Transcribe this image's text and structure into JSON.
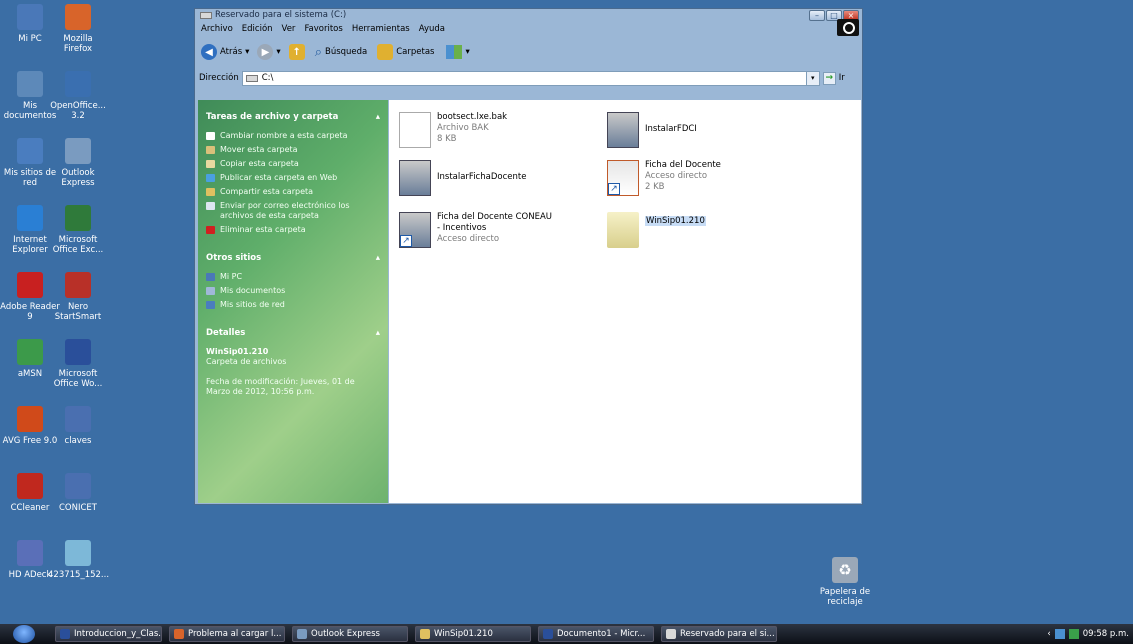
{
  "desktop_icons": [
    {
      "label": "Mi PC",
      "icon": "computer-icon",
      "color": "#4a78b8"
    },
    {
      "label": "Mozilla Firefox",
      "icon": "firefox-icon",
      "color": "#d8642a"
    },
    {
      "label": "Mis documentos",
      "icon": "folder-documents-icon",
      "color": "#5d89b9"
    },
    {
      "label": "OpenOffice... 3.2",
      "icon": "openoffice-icon",
      "color": "#3a6fb0"
    },
    {
      "label": "Mis sitios de red",
      "icon": "network-icon",
      "color": "#4a7dbf"
    },
    {
      "label": "Outlook Express",
      "icon": "outlook-express-icon",
      "color": "#7a9bc0"
    },
    {
      "label": "Internet Explorer",
      "icon": "internet-explorer-icon",
      "color": "#2a7fd4"
    },
    {
      "label": "Microsoft Office Exc...",
      "icon": "excel-icon",
      "color": "#2f7a3a"
    },
    {
      "label": "Adobe Reader 9",
      "icon": "adobe-reader-icon",
      "color": "#c82020"
    },
    {
      "label": "Nero StartSmart",
      "icon": "nero-icon",
      "color": "#b83028"
    },
    {
      "label": "aMSN",
      "icon": "amsn-icon",
      "color": "#3c9a4a"
    },
    {
      "label": "Microsoft Office Wo...",
      "icon": "word-icon",
      "color": "#2a4f9a"
    },
    {
      "label": "AVG Free 9.0",
      "icon": "avg-icon",
      "color": "#d04a1a"
    },
    {
      "label": "claves",
      "icon": "word-doc-icon",
      "color": "#4a6fb0"
    },
    {
      "label": "CCleaner",
      "icon": "ccleaner-icon",
      "color": "#c0281e"
    },
    {
      "label": "CONICET",
      "icon": "word-doc-icon",
      "color": "#4a6fb0"
    },
    {
      "label": "HD ADeck",
      "icon": "hdadeck-icon",
      "color": "#5a6fb8"
    },
    {
      "label": "423715_152...",
      "icon": "image-file-icon",
      "color": "#7db8d8"
    }
  ],
  "recycle_bin": {
    "label": "Papelera de reciclaje",
    "icon": "recycle-bin-icon"
  },
  "window": {
    "title": "Reservado para el sistema (C:)",
    "menu": [
      "Archivo",
      "Edición",
      "Ver",
      "Favoritos",
      "Herramientas",
      "Ayuda"
    ],
    "toolbar": {
      "back": "Atrás",
      "search": "Búsqueda",
      "folders": "Carpetas"
    },
    "address": {
      "label": "Dirección",
      "value": "C:\\",
      "go": "Ir"
    }
  },
  "tasks": {
    "file_tasks": {
      "title": "Tareas de archivo y carpeta",
      "items": [
        {
          "label": "Cambiar nombre a esta carpeta",
          "color": "#ffffff"
        },
        {
          "label": "Mover esta carpeta",
          "color": "#d9c07a"
        },
        {
          "label": "Copiar esta carpeta",
          "color": "#e8d9a0"
        },
        {
          "label": "Publicar esta carpeta en Web",
          "color": "#4aa0e0"
        },
        {
          "label": "Compartir esta carpeta",
          "color": "#e0c060"
        },
        {
          "label": "Enviar por correo electrónico los archivos de esta carpeta",
          "color": "#dde6f0"
        },
        {
          "label": "Eliminar esta carpeta",
          "color": "#d02020"
        }
      ]
    },
    "other_places": {
      "title": "Otros sitios",
      "items": [
        {
          "label": "Mi PC",
          "color": "#4a78b8"
        },
        {
          "label": "Mis documentos",
          "color": "#a0b8d8"
        },
        {
          "label": "Mis sitios de red",
          "color": "#4a7dbf"
        }
      ]
    },
    "details": {
      "title": "Detalles",
      "name": "WinSip01.210",
      "type": "Carpeta de archivos",
      "modified": "Fecha de modificación: Jueves, 01 de Marzo de 2012, 10:56 p.m."
    }
  },
  "files": [
    {
      "name": "bootsect.lxe.bak",
      "type": "Archivo BAK",
      "size": "8 KB",
      "icon": "document-icon"
    },
    {
      "name": "InstalarFDCI",
      "type": "",
      "size": "",
      "icon": "installer-icon"
    },
    {
      "name": "InstalarFichaDocente",
      "type": "",
      "size": "",
      "icon": "installer-icon"
    },
    {
      "name": "Ficha del Docente",
      "type": "Acceso directo",
      "size": "2 KB",
      "icon": "shortcut-document-icon"
    },
    {
      "name": "Ficha del Docente CONEAU - Incentivos",
      "type": "Acceso directo",
      "size": "",
      "icon": "shortcut-installer-icon"
    },
    {
      "name": "WinSip01.210",
      "type": "",
      "size": "",
      "icon": "folder-icon"
    }
  ],
  "taskbar": {
    "buttons": [
      {
        "label": "Introduccion_y_Clas...",
        "color": "#2a4f9a"
      },
      {
        "label": "Problema al cargar l...",
        "color": "#d8642a"
      },
      {
        "label": "Outlook Express",
        "color": "#7a9bc0"
      },
      {
        "label": "WinSip01.210",
        "color": "#e0c060"
      },
      {
        "label": "Documento1 - Micr...",
        "color": "#2a4f9a"
      },
      {
        "label": "Reservado para el si...",
        "color": "#d8d8d8"
      }
    ],
    "clock": "09:58 p.m."
  }
}
